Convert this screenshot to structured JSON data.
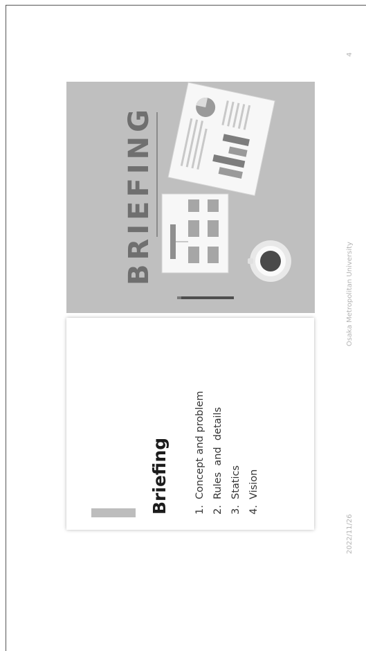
{
  "slide": {
    "title": "Briefing",
    "agenda": [
      {
        "num": "1.",
        "label": "Concept and problem"
      },
      {
        "num": "2.",
        "label": "Rules  and  details"
      },
      {
        "num": "3.",
        "label": "Statics"
      },
      {
        "num": "4.",
        "label": "Vision"
      }
    ],
    "illustration_text": "BRIEFING"
  },
  "footer": {
    "date": "2022/11/26",
    "organization": "Osaka Metropolitan University",
    "page_number": "4"
  }
}
